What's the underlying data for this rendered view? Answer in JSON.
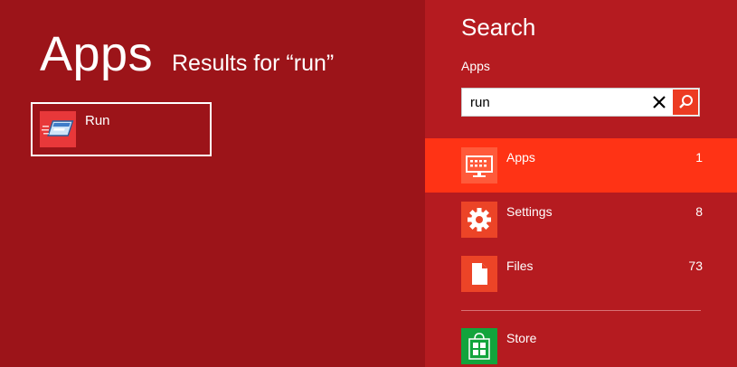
{
  "results": {
    "title": "Apps",
    "subtitle": "Results for “run”",
    "items": [
      {
        "label": "Run",
        "icon": "run-app-icon"
      }
    ]
  },
  "charm": {
    "title": "Search",
    "scope": "Apps",
    "search": {
      "value": "run",
      "placeholder": ""
    },
    "categories": [
      {
        "label": "Apps",
        "count": "1",
        "icon": "keyboard-monitor-icon",
        "selected": true
      },
      {
        "label": "Settings",
        "count": "8",
        "icon": "gear-icon",
        "selected": false
      },
      {
        "label": "Files",
        "count": "73",
        "icon": "document-icon",
        "selected": false
      }
    ],
    "apps": [
      {
        "label": "Store",
        "icon": "store-bag-icon"
      }
    ]
  },
  "colors": {
    "background": "#9c1419",
    "charm": "#b51b20",
    "selected": "#ff3315",
    "store": "#12a43c"
  }
}
